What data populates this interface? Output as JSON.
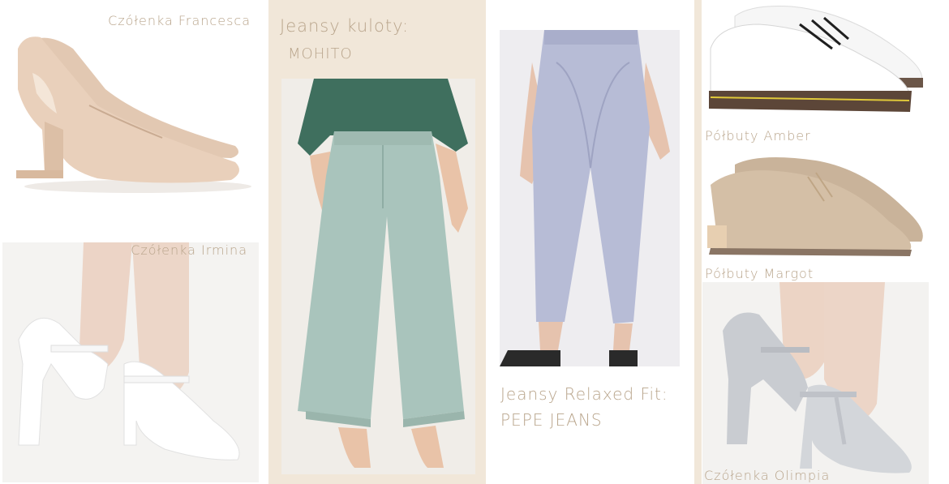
{
  "labels": {
    "francesca": "Czółenka Francesca",
    "irmina": "Czółenka Irmina",
    "kuloty_title": "Jeansy kuloty:",
    "kuloty_brand": "MOHITO",
    "relaxed_title": "Jeansy Relaxed Fit:",
    "relaxed_brand": "PEPE JEANS",
    "amber": "Półbuty Amber",
    "margot": "Półbuty Margot",
    "olimpia": "Czółenka Olimpia"
  },
  "colors": {
    "background": "#ffffff",
    "panel_beige": "#f1e7d9",
    "label_text": "#b9a58c"
  }
}
